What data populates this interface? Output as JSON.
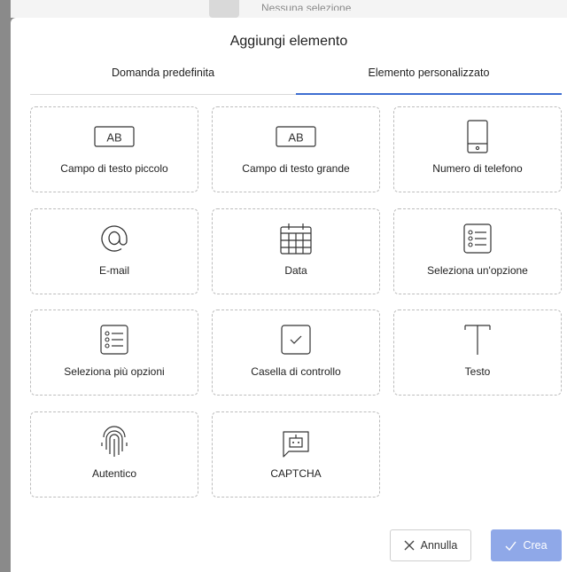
{
  "background": {
    "selection_text": "Nessuna selezione"
  },
  "dialog": {
    "title": "Aggiungi elemento",
    "tabs": [
      {
        "label": "Domanda predefinita",
        "active": false
      },
      {
        "label": "Elemento personalizzato",
        "active": true
      }
    ],
    "items": [
      {
        "label": "Campo di testo piccolo",
        "icon": "text-field-small-icon"
      },
      {
        "label": "Campo di testo grande",
        "icon": "text-field-large-icon"
      },
      {
        "label": "Numero di telefono",
        "icon": "phone-icon"
      },
      {
        "label": "E-mail",
        "icon": "at-sign-icon"
      },
      {
        "label": "Data",
        "icon": "calendar-icon"
      },
      {
        "label": "Seleziona un'opzione",
        "icon": "single-select-list-icon"
      },
      {
        "label": "Seleziona più opzioni",
        "icon": "multi-select-list-icon"
      },
      {
        "label": "Casella di controllo",
        "icon": "checkbox-icon"
      },
      {
        "label": "Testo",
        "icon": "text-cursor-icon"
      },
      {
        "label": "Autentico",
        "icon": "fingerprint-icon"
      },
      {
        "label": "CAPTCHA",
        "icon": "robot-icon"
      }
    ],
    "buttons": {
      "cancel_label": "Annulla",
      "create_label": "Crea"
    }
  },
  "colors": {
    "accent": "#3e6fd1",
    "create_button": "#8fa8e8",
    "card_border": "#bdbdbd"
  }
}
